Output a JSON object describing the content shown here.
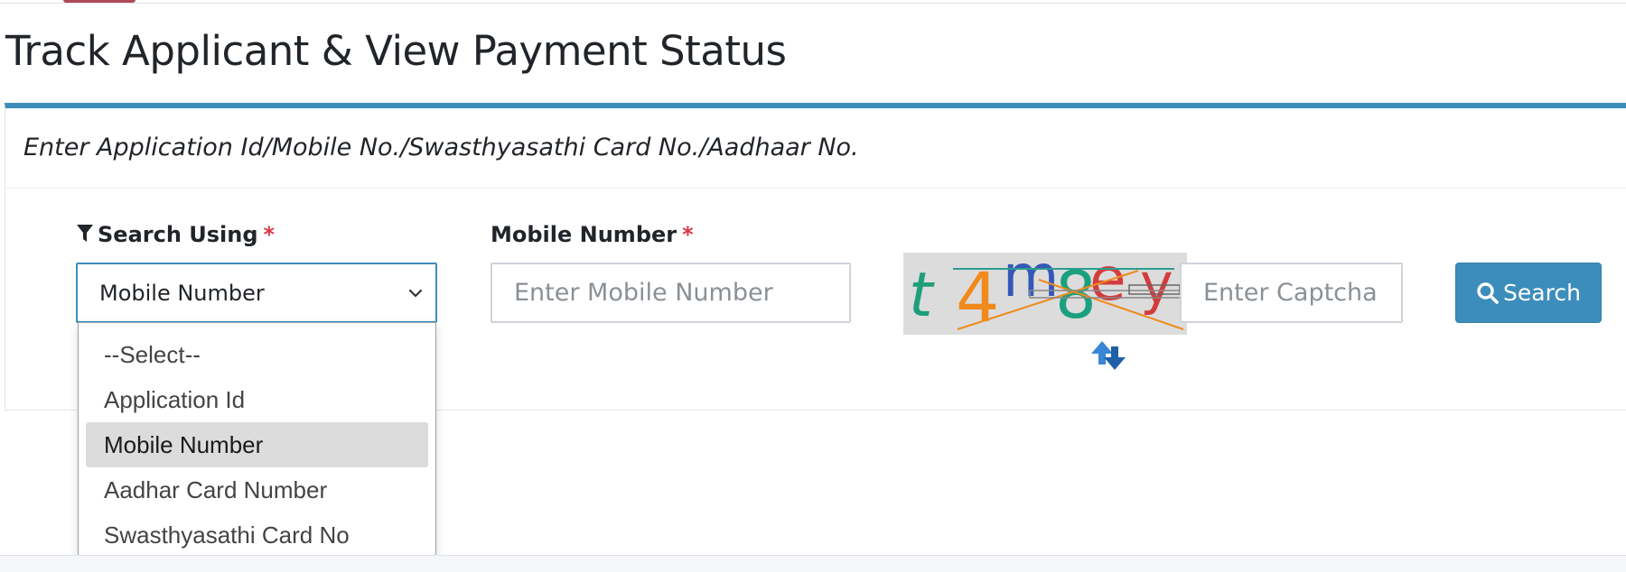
{
  "page": {
    "title": "Track Applicant & View Payment Status",
    "subtitle": "Enter Application Id/Mobile No./Swasthyasathi Card No./Aadhaar No."
  },
  "form": {
    "search_using": {
      "label": "Search Using",
      "required_mark": "*",
      "icon": "filter-icon",
      "selected": "Mobile Number"
    },
    "mobile": {
      "label": "Mobile Number",
      "required_mark": "*",
      "placeholder": "Enter Mobile Number",
      "value": ""
    },
    "captcha": {
      "image_text": "t 4m8ey",
      "placeholder": "Enter Captcha",
      "value": "",
      "refresh_icon": "refresh-icon"
    },
    "search_button": {
      "label": "Search",
      "icon": "search-icon"
    }
  },
  "dropdown": {
    "options": [
      {
        "label": "--Select--",
        "selected": false
      },
      {
        "label": "Application Id",
        "selected": false
      },
      {
        "label": "Mobile Number",
        "selected": true
      },
      {
        "label": "Aadhar Card Number",
        "selected": false
      },
      {
        "label": "Swasthyasathi Card No",
        "selected": false
      }
    ]
  },
  "colors": {
    "primary": "#3c8dbc",
    "required": "#dc3545",
    "option_highlight": "#dcdcdc"
  }
}
